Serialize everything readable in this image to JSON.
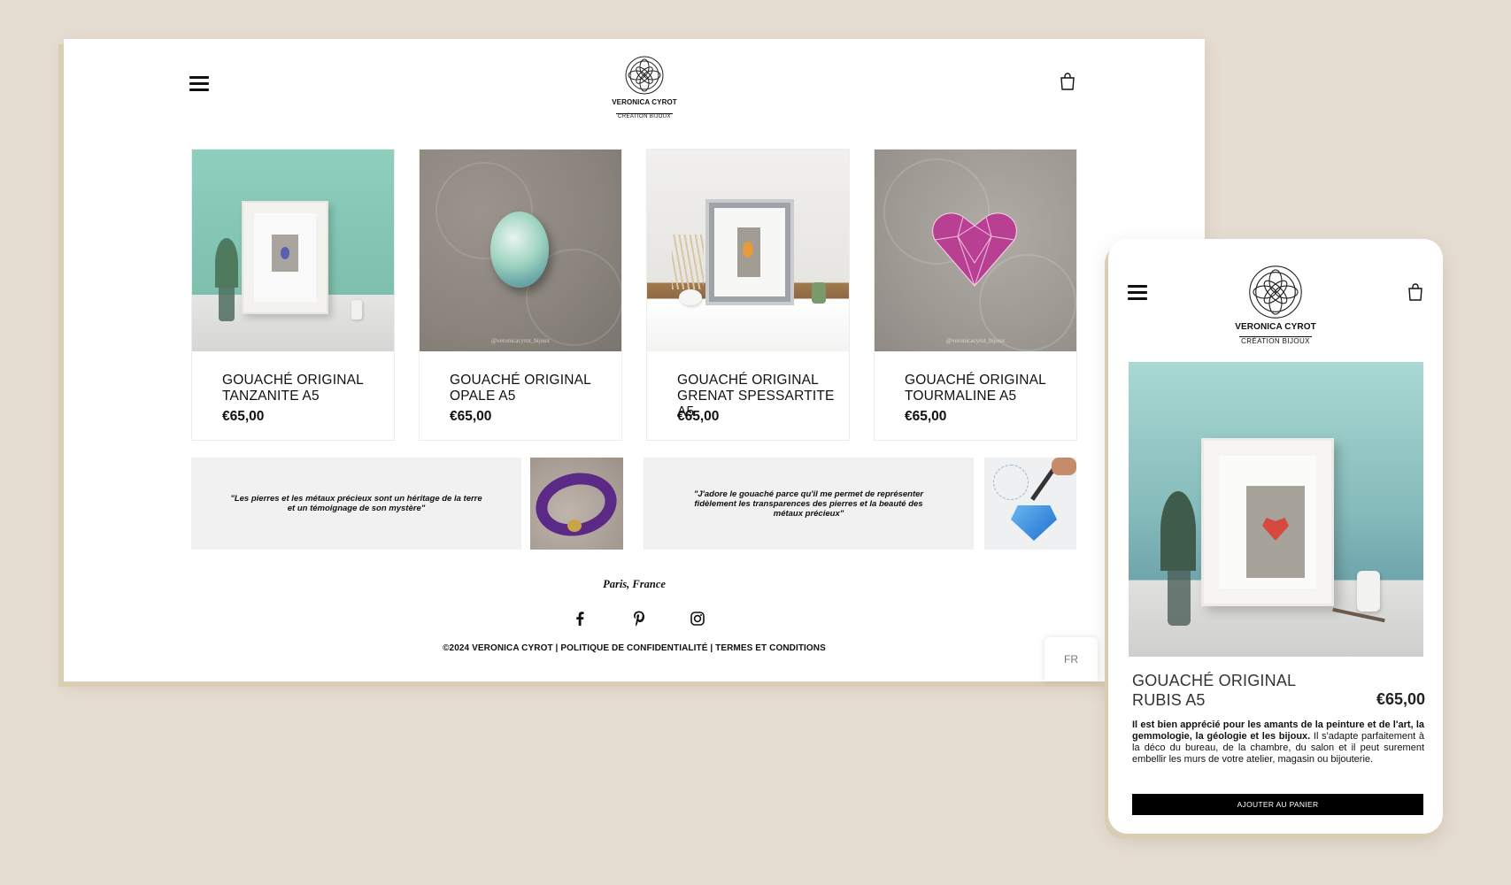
{
  "brand": {
    "name": "VERONICA CYROT",
    "tagline": "CRÉATION BIJOUX"
  },
  "desktop": {
    "products": [
      {
        "title": "GOUACHÉ ORIGINAL TANZANITE A5",
        "price": "€65,00"
      },
      {
        "title": "GOUACHÉ ORIGINAL OPALE A5",
        "price": "€65,00",
        "watermark": "@veronicacyrot_bijoux"
      },
      {
        "title": "GOUACHÉ ORIGINAL GRENAT SPESSARTITE A5",
        "price": "€65,00"
      },
      {
        "title": "GOUACHÉ ORIGINAL TOURMALINE A5",
        "price": "€65,00",
        "watermark": "@veronicacyrot_bijoux"
      }
    ],
    "quotes": [
      {
        "text": "\"Les pierres et les métaux précieux sont un héritage de la terre et un témoignage de son mystère\""
      },
      {
        "text": "\"J'adore le gouaché parce qu'il me permet de représenter fidèlement les transparences des pierres et la beauté des métaux précieux\""
      }
    ],
    "footer": {
      "location": "Paris, France",
      "legal": "©2024 VERONICA CYROT | POLITIQUE DE CONFIDENTIALITÉ | TERMES ET CONDITIONS",
      "socials": [
        "facebook-icon",
        "pinterest-icon",
        "instagram-icon"
      ]
    },
    "language": "FR"
  },
  "mobile": {
    "product": {
      "title": "GOUACHÉ ORIGINAL RUBIS A5",
      "price": "€65,00",
      "desc_bold": "Il est bien apprécié pour les amants de la peinture et de l'art, la gemmologie, la géologie et les bijoux.",
      "desc_rest": " Il s'adapte parfaitement à la déco du bureau, de la chambre, du salon et il peut surement embellir les murs de votre atelier, magasin ou bijouterie.",
      "cta": "AJOUTER AU PANIER"
    }
  },
  "colors": {
    "background": "#e6ddd2",
    "quote_bg": "#f1f1f1",
    "button": "#000000"
  }
}
